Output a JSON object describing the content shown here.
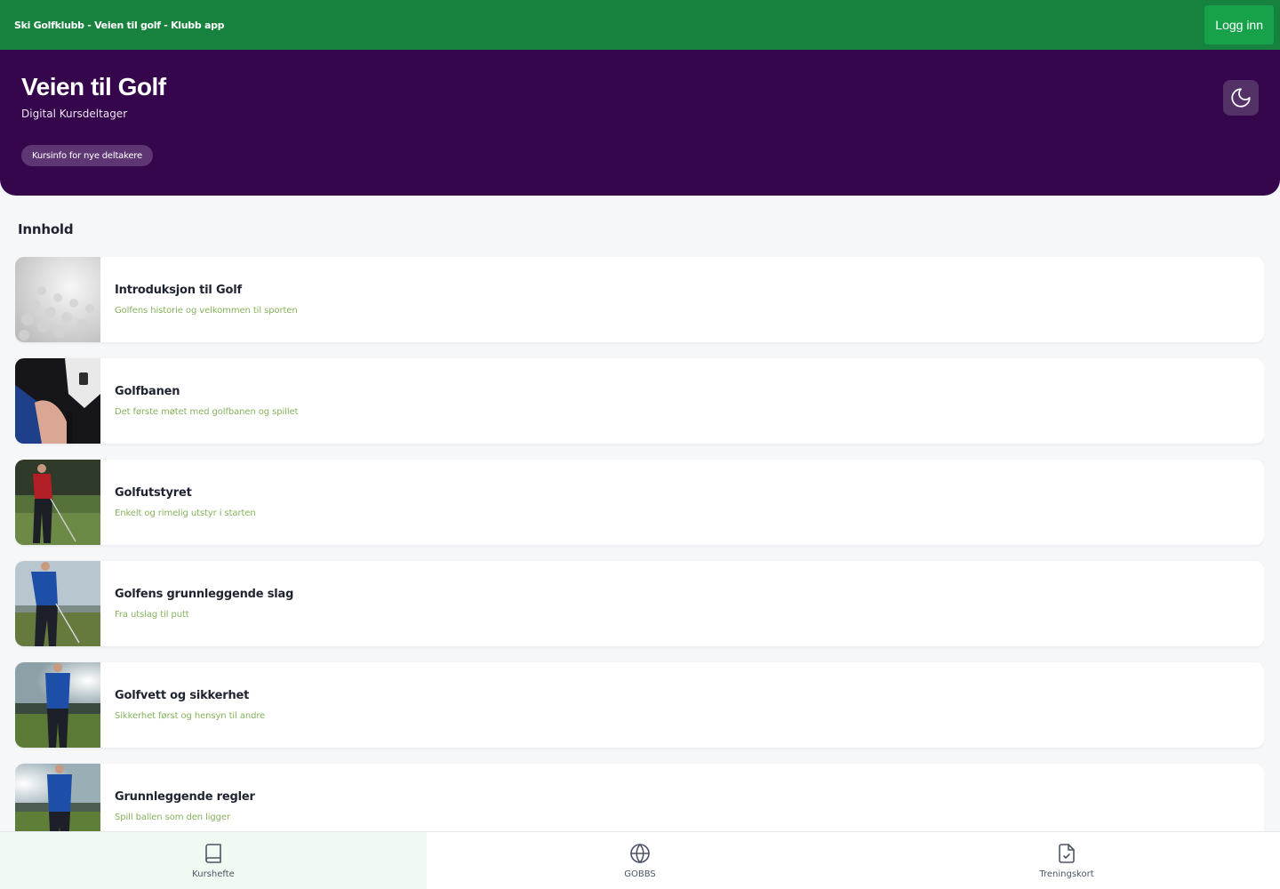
{
  "app": {
    "title": "Ski Golfklubb - Veien til golf - Klubb app",
    "login_label": "Logg inn"
  },
  "hero": {
    "title": "Veien til Golf",
    "subtitle": "Digital Kursdeltager",
    "info_pill": "Kursinfo for nye deltakere",
    "theme_icon": "moon-icon"
  },
  "content": {
    "heading": "Innhold",
    "items": [
      {
        "title": "Introduksjon til Golf",
        "subtitle": "Golfens historie og velkommen til sporten",
        "image": "golf-ball-closeup"
      },
      {
        "title": "Golfbanen",
        "subtitle": "Det første møtet med golfbanen og spillet",
        "image": "gloved-hands-grip"
      },
      {
        "title": "Golfutstyret",
        "subtitle": "Enkelt og rimelig utstyr i starten",
        "image": "golfer-red-shirt"
      },
      {
        "title": "Golfens grunnleggende slag",
        "subtitle": "Fra utslag til putt",
        "image": "golfer-blue-jacket"
      },
      {
        "title": "Golfvett og sikkerhet",
        "subtitle": "Sikkerhet først og hensyn til andre",
        "image": "golfer-sunset"
      },
      {
        "title": "Grunnleggende regler",
        "subtitle": "Spill ballen som den ligger",
        "image": "golfer-sea-view"
      }
    ]
  },
  "nav": [
    {
      "label": "Kurshefte",
      "icon": "book-icon",
      "active": true
    },
    {
      "label": "GOBBS",
      "icon": "globe-icon",
      "active": false
    },
    {
      "label": "Treningskort",
      "icon": "file-check-icon",
      "active": false
    }
  ],
  "colors": {
    "topbar": "#17813e",
    "hero": "#35064b",
    "accent_green": "#17a14a",
    "subtitle_green": "#86b25c"
  }
}
